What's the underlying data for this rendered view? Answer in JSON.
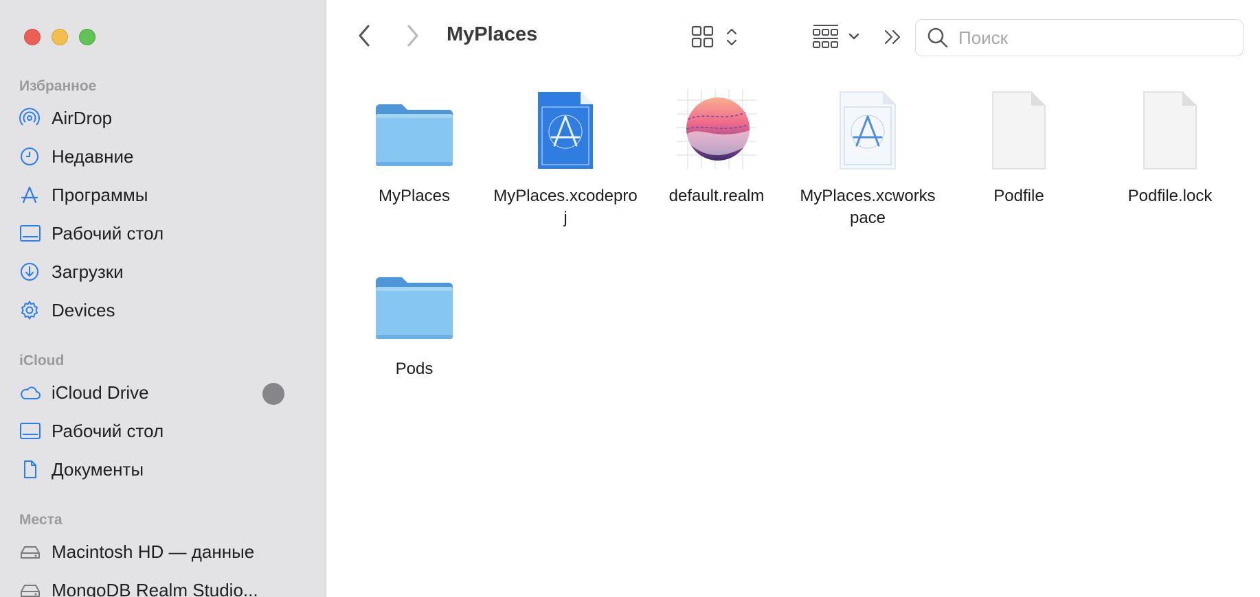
{
  "window": {
    "title": "MyPlaces"
  },
  "toolbar": {
    "back_icon": "chevron-left-icon",
    "forward_icon": "chevron-right-icon",
    "view_icon": "grid-icon",
    "group_icon": "group-by-icon",
    "more_icon": "double-chevron-icon",
    "search_placeholder": "Поиск"
  },
  "sidebar": {
    "favorites_header": "Избранное",
    "favorites": [
      {
        "label": "AirDrop",
        "icon": "airdrop-icon"
      },
      {
        "label": "Недавние",
        "icon": "clock-icon"
      },
      {
        "label": "Программы",
        "icon": "applications-icon"
      },
      {
        "label": "Рабочий стол",
        "icon": "desktop-icon"
      },
      {
        "label": "Загрузки",
        "icon": "download-icon"
      },
      {
        "label": "Devices",
        "icon": "gear-icon"
      }
    ],
    "icloud_header": "iCloud",
    "icloud": [
      {
        "label": "iCloud Drive",
        "icon": "cloud-icon"
      },
      {
        "label": "Рабочий стол",
        "icon": "desktop-icon"
      },
      {
        "label": "Документы",
        "icon": "document-icon"
      }
    ],
    "places_header": "Места",
    "places": [
      {
        "label": "Macintosh HD — данные",
        "icon": "drive-icon"
      },
      {
        "label": "MongoDB Realm Studio...",
        "icon": "drive-icon"
      }
    ]
  },
  "files": [
    {
      "name": "MyPlaces",
      "kind": "folder-icon"
    },
    {
      "name": "MyPlaces.xcodeproj",
      "kind": "xcodeproj-icon"
    },
    {
      "name": "default.realm",
      "kind": "realm-icon"
    },
    {
      "name": "MyPlaces.xcworkspace",
      "kind": "xcworkspace-icon"
    },
    {
      "name": "Podfile",
      "kind": "blank-document-icon"
    },
    {
      "name": "Podfile.lock",
      "kind": "blank-document-icon"
    },
    {
      "name": "Pods",
      "kind": "folder-icon"
    }
  ],
  "colors": {
    "accent": "#2b7cf0",
    "sidebar_bg": "#e3e3e6",
    "folder": "#7fbff0"
  }
}
